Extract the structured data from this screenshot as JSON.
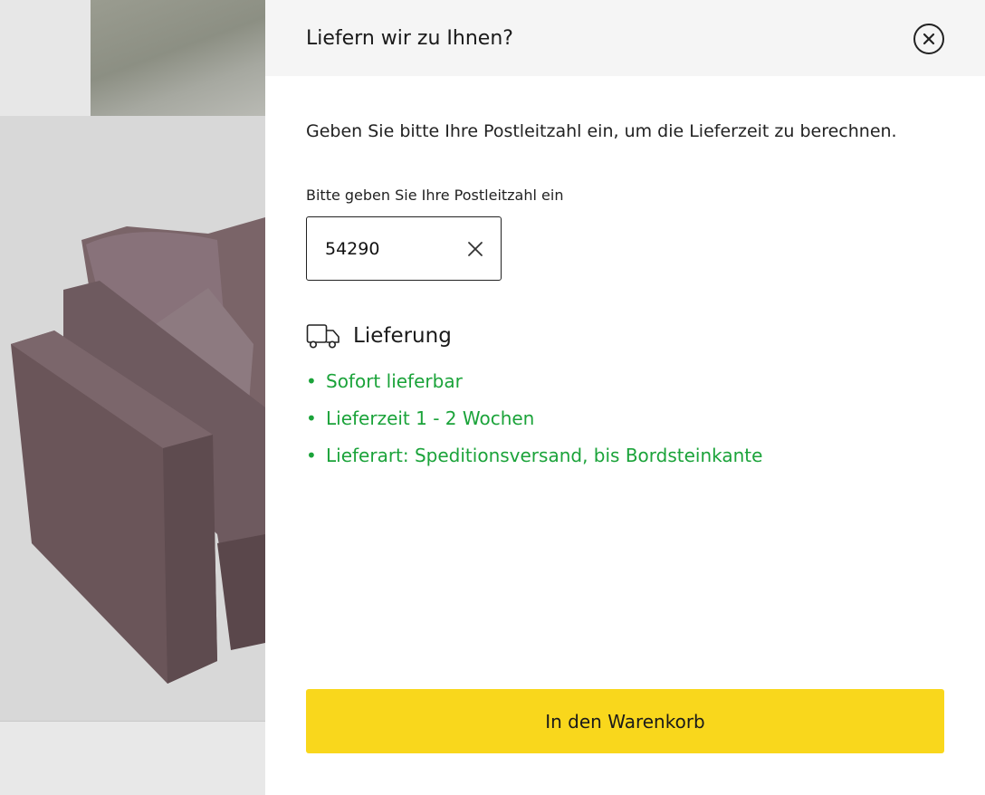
{
  "drawer": {
    "title": "Liefern wir zu Ihnen?",
    "intro": "Geben Sie bitte Ihre Postleitzahl ein, um die Lieferzeit zu berechnen.",
    "zip_label": "Bitte geben Sie Ihre Postleitzahl ein",
    "zip_value": "54290",
    "delivery_title": "Lieferung",
    "delivery_items": [
      "Sofort lieferbar",
      "Lieferzeit 1 - 2 Wochen",
      "Lieferart: Speditionsversand, bis Bordsteinkante"
    ],
    "cart_button": "In den Warenkorb"
  },
  "icons": {
    "close": "close-icon",
    "clear": "clear-icon",
    "delivery": "truck-icon"
  },
  "colors": {
    "accent": "#f9d71c",
    "success": "#1ba33a",
    "header_bg": "#f5f5f5"
  }
}
